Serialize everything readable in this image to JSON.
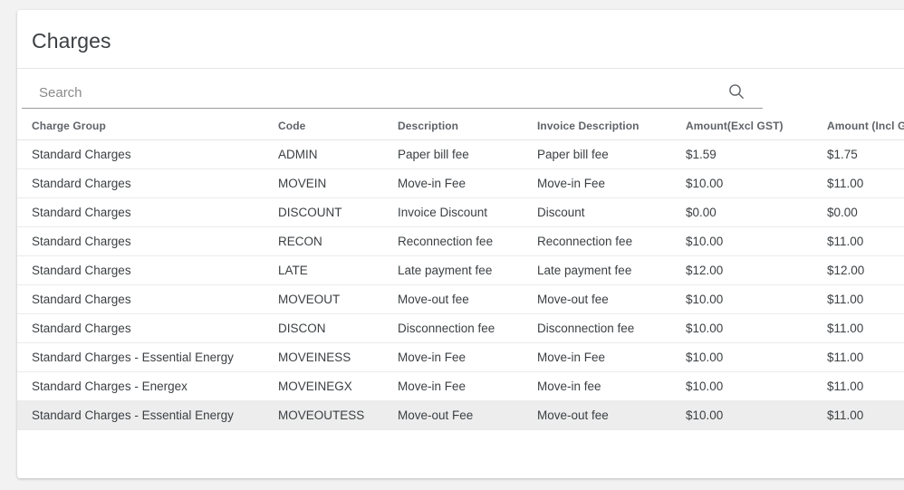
{
  "card": {
    "title": "Charges"
  },
  "search": {
    "placeholder": "Search",
    "value": "",
    "icon": "search-icon"
  },
  "table": {
    "columns": [
      "Charge Group",
      "Code",
      "Description",
      "Invoice Description",
      "Amount(Excl GST)",
      "Amount (Incl GST)"
    ],
    "hovered_row_index": 9,
    "rows": [
      {
        "charge_group": "Standard Charges",
        "code": "ADMIN",
        "description": "Paper bill fee",
        "invoice_description": "Paper bill fee",
        "amount_excl_gst": "$1.59",
        "amount_incl_gst": "$1.75"
      },
      {
        "charge_group": "Standard Charges",
        "code": "MOVEIN",
        "description": "Move-in Fee",
        "invoice_description": "Move-in Fee",
        "amount_excl_gst": "$10.00",
        "amount_incl_gst": "$11.00"
      },
      {
        "charge_group": "Standard Charges",
        "code": "DISCOUNT",
        "description": "Invoice Discount",
        "invoice_description": "Discount",
        "amount_excl_gst": "$0.00",
        "amount_incl_gst": "$0.00"
      },
      {
        "charge_group": "Standard Charges",
        "code": "RECON",
        "description": "Reconnection fee",
        "invoice_description": "Reconnection fee",
        "amount_excl_gst": "$10.00",
        "amount_incl_gst": "$11.00"
      },
      {
        "charge_group": "Standard Charges",
        "code": "LATE",
        "description": "Late payment fee",
        "invoice_description": "Late payment fee",
        "amount_excl_gst": "$12.00",
        "amount_incl_gst": "$12.00"
      },
      {
        "charge_group": "Standard Charges",
        "code": "MOVEOUT",
        "description": "Move-out fee",
        "invoice_description": "Move-out fee",
        "amount_excl_gst": "$10.00",
        "amount_incl_gst": "$11.00"
      },
      {
        "charge_group": "Standard Charges",
        "code": "DISCON",
        "description": "Disconnection fee",
        "invoice_description": "Disconnection fee",
        "amount_excl_gst": "$10.00",
        "amount_incl_gst": "$11.00"
      },
      {
        "charge_group": "Standard Charges - Essential Energy",
        "code": "MOVEINESS",
        "description": "Move-in Fee",
        "invoice_description": "Move-in Fee",
        "amount_excl_gst": "$10.00",
        "amount_incl_gst": "$11.00"
      },
      {
        "charge_group": "Standard Charges - Energex",
        "code": "MOVEINEGX",
        "description": "Move-in Fee",
        "invoice_description": "Move-in fee",
        "amount_excl_gst": "$10.00",
        "amount_incl_gst": "$11.00"
      },
      {
        "charge_group": "Standard Charges - Essential Energy",
        "code": "MOVEOUTESS",
        "description": "Move-out Fee",
        "invoice_description": "Move-out fee",
        "amount_excl_gst": "$10.00",
        "amount_incl_gst": "$11.00"
      }
    ]
  }
}
